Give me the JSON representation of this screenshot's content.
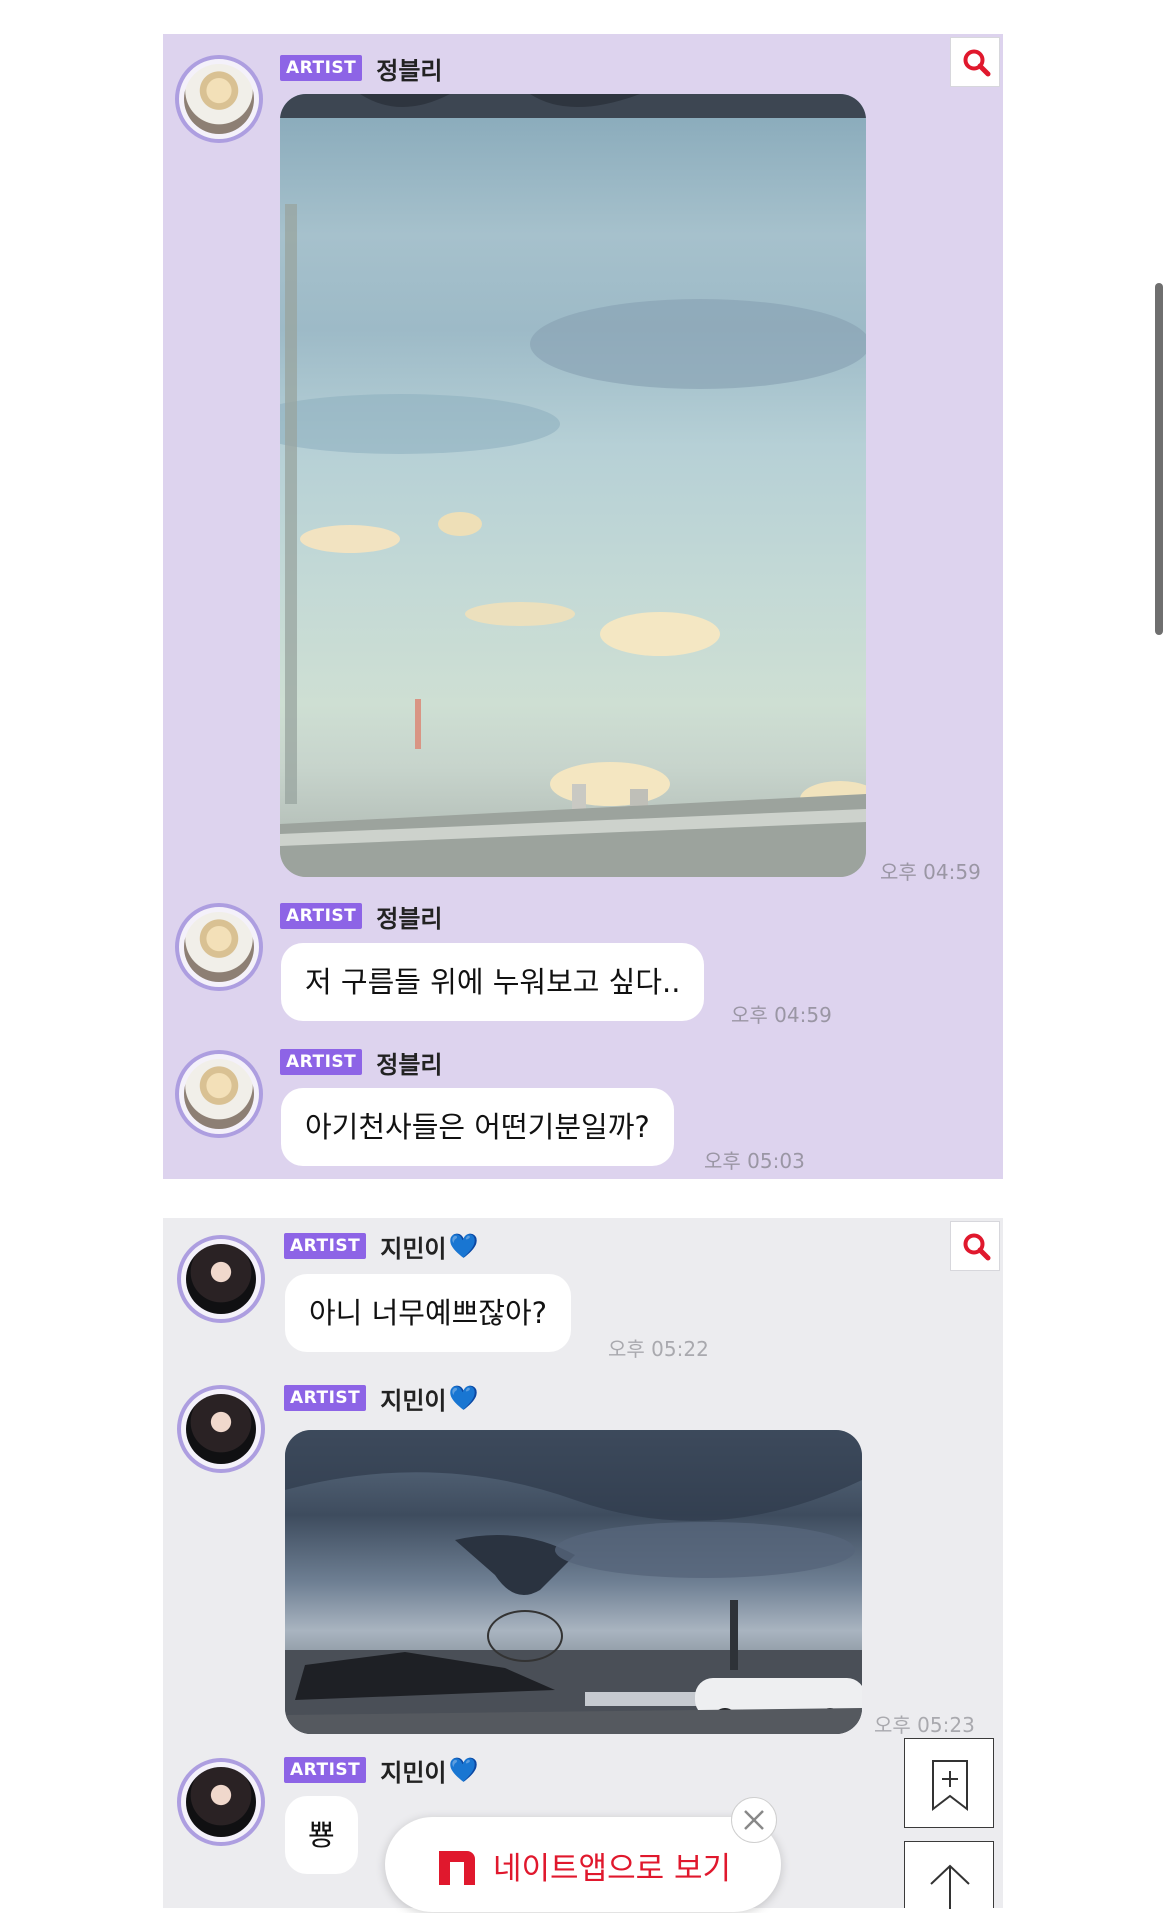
{
  "search": {
    "icon": "search-icon",
    "color": "#e0182d"
  },
  "messages_a": [
    {
      "badge": "ARTIST",
      "author": "정블리",
      "time": "오후 04:59"
    },
    {
      "badge": "ARTIST",
      "author": "정블리",
      "text": "저 구름들 위에 누워보고 싶다..",
      "time": "오후 04:59"
    },
    {
      "badge": "ARTIST",
      "author": "정블리",
      "text": "아기천사들은 어떤기분일까?",
      "time": "오후 05:03"
    }
  ],
  "messages_b": [
    {
      "badge": "ARTIST",
      "author": "지민이",
      "heart": "💙",
      "text": "아니 너무예쁘잖아?",
      "time": "오후 05:22"
    },
    {
      "badge": "ARTIST",
      "author": "지민이",
      "heart": "💙",
      "time": "오후 05:23"
    },
    {
      "badge": "ARTIST",
      "author": "지민이",
      "heart": "💙",
      "text": "뿅"
    }
  ],
  "nate_button": {
    "label": "네이트앱으로 보기",
    "logo": "n-logo-icon",
    "close_icon": "close-icon"
  },
  "side_buttons": {
    "bookmark_icon": "bookmark-icon",
    "top_icon": "arrow-up-icon"
  }
}
